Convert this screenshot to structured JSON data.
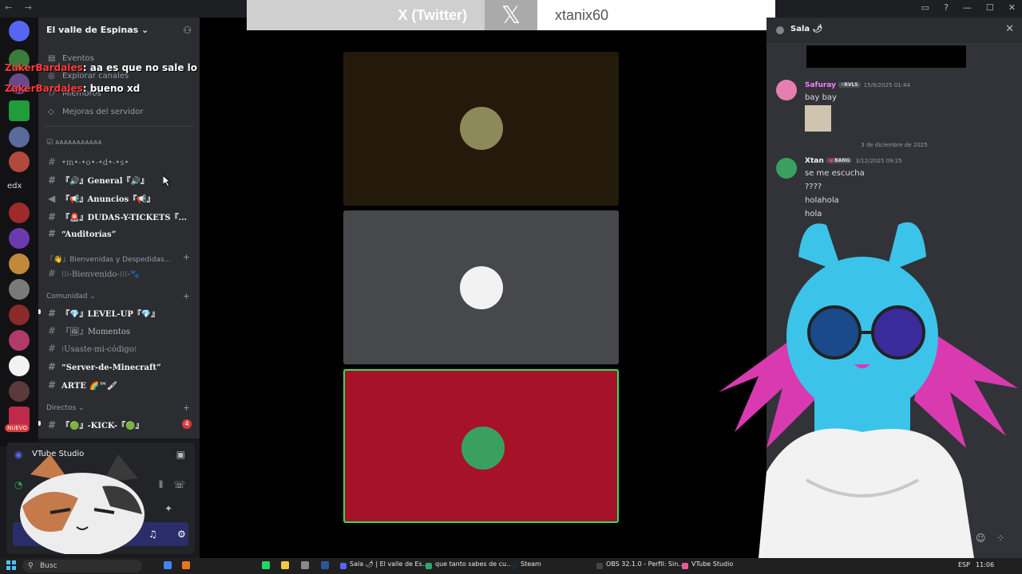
{
  "window": {
    "nav_symbols": "← →"
  },
  "server": {
    "name": "El valle de Espinas ⌄"
  },
  "server_items": [
    "Eventos",
    "Explorar canales",
    "Miembros",
    "Mejoras del servidor"
  ],
  "category_top": "ᴀᴀᴀᴀᴀᴀᴀᴀᴀᴀᴀ",
  "channels_top": [
    "•m•-•o•-•d•-•s•",
    "『🔊』General『🔊』",
    "『📢』Anuncios『📢』",
    "『🚨』DUDAS-Y-TICKETS『...",
    "“Auditorías”"
  ],
  "category_welcome": "『👋』Bienvenidas y Despedidas...",
  "channel_welcome": "⁝⁝⁝-Bienvenido-⁝⁝⁝-🐾",
  "category_community": "Comunidad ⌄",
  "channels_community": [
    "『💎』LEVEL-UP『💎』",
    "『🖼』Momentos",
    "⁝Usaste-mi-código⁝",
    "“Server-de-Minecraft”",
    "ARTE 🌈™🖌"
  ],
  "category_directos": "Directos ⌄",
  "channel_kick": "『🟢』-KICK-『🟢』",
  "channel_kick_badge": "4",
  "rail": {
    "edx_label": "edx",
    "nuevo_label": "NUEVO"
  },
  "overlay_chat": [
    {
      "user": "ZakerBardales",
      "text": ": aa es que no sale lo demas"
    },
    {
      "user": "ZakerBardales",
      "text": ": bueno xd"
    }
  ],
  "voice_panel": {
    "label": "VTube Studio"
  },
  "social_banner": {
    "label": "X (Twitter)",
    "logo": "𝕏",
    "handle": "xtanix60"
  },
  "call_tiles": [
    {
      "bg": "#241a0c",
      "border": "#241a0c"
    },
    {
      "bg": "#46484c",
      "border": "#46484c"
    },
    {
      "bg": "#a6122a",
      "border": "#2fe05a"
    }
  ],
  "chat_panel": {
    "title": "Sala 🌶",
    "messages": [
      {
        "user": "Safuray",
        "tag": "⚡RVLS",
        "time": "15/8/2025 01:44",
        "lines": [
          "bay bay"
        ],
        "color": "#f47fff"
      },
      {
        "date_divider": "3 de diciembre de 2025"
      },
      {
        "user": "Xtan",
        "tag": "💗BANG",
        "time": "3/12/2025 09:25",
        "lines": [
          "se me escucha",
          "????",
          "holahola",
          "hola"
        ],
        "color": "#f2f3f5"
      }
    ]
  },
  "taskbar": {
    "search": "Busc",
    "apps": [
      "Sala 🌶 | El valle de Es...",
      "que tanto sabes de cu...",
      "Steam",
      "OBS 32.1.0 - Perfil: Sin...",
      "VTube Studio"
    ],
    "lang": "ESP",
    "time": "11:06"
  },
  "colors": {
    "accent": "#5865f2",
    "overlay_user": "#ff3b3b",
    "model_body": "#3cc3ea",
    "model_hair": "#d93ab0"
  }
}
